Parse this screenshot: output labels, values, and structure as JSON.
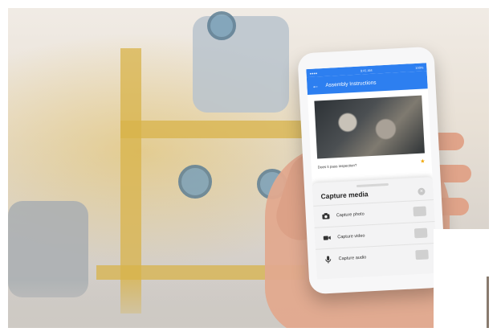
{
  "status": {
    "time": "9:41 AM",
    "battery": "100%"
  },
  "app": {
    "title": "Assembly Instructions",
    "back_icon": "arrow-left-icon"
  },
  "question": {
    "text": "Does it pass inspection?",
    "icon": "star-icon"
  },
  "sheet": {
    "title": "Capture media",
    "close_icon": "close-icon",
    "options": [
      {
        "label": "Capture photo",
        "icon": "camera-icon"
      },
      {
        "label": "Capture video",
        "icon": "video-icon"
      },
      {
        "label": "Capture audio",
        "icon": "microphone-icon"
      }
    ]
  },
  "colors": {
    "app_bar": "#2d7ff0",
    "accent_star": "#f0a400"
  }
}
